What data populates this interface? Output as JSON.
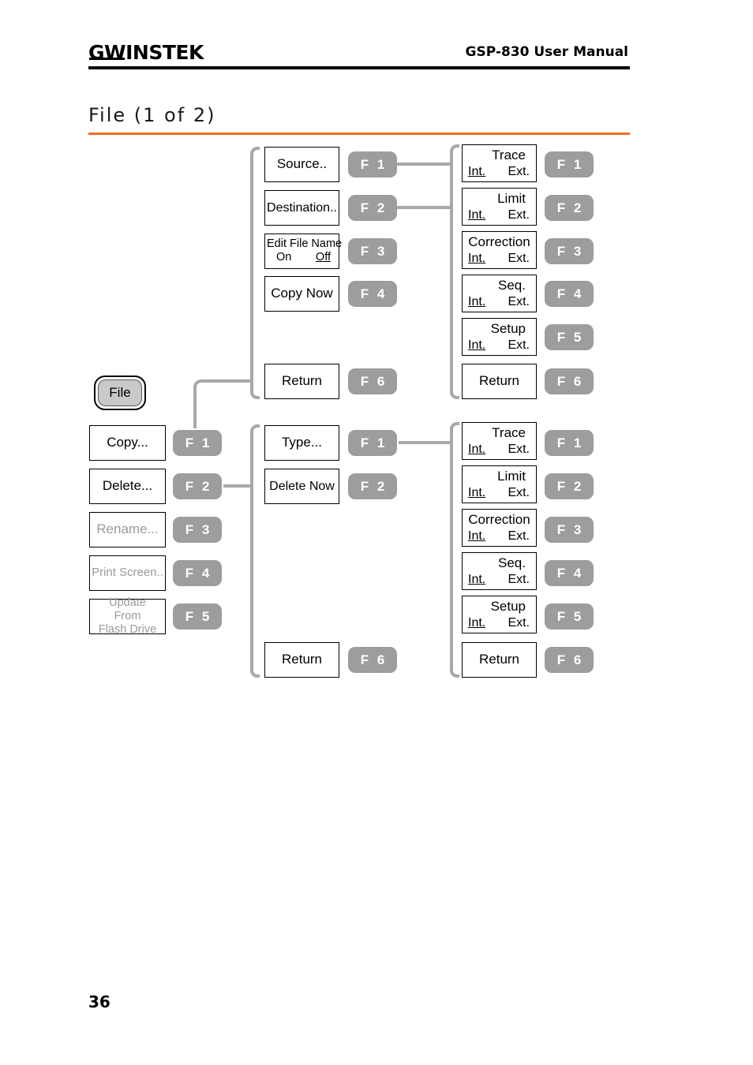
{
  "header": {
    "logo_gw": "GW",
    "logo_instek": "INSTEK",
    "manual_title": "GSP-830 User Manual"
  },
  "page": {
    "title": "File (1 of 2)",
    "number": "36",
    "accent_color": "#ef6f22",
    "connector_color": "#a8a8a8",
    "fkey_color": "#9d9d9d"
  },
  "hardkey": {
    "label": "File"
  },
  "column1": {
    "items": [
      {
        "label": "Copy...",
        "fkey": "F  1",
        "dim": false
      },
      {
        "label": "Delete...",
        "fkey": "F  2",
        "dim": false
      },
      {
        "label": "Rename...",
        "fkey": "F  3",
        "dim": true
      },
      {
        "label": "Print Screen..",
        "fkey": "F  4",
        "dim": true
      },
      {
        "label": "Update\nFrom\nFlash Drive",
        "line1": "Update",
        "line2": "From",
        "line3": "Flash Drive",
        "fkey": "F  5",
        "dim": true
      }
    ]
  },
  "column2_copy": {
    "items": [
      {
        "label": "Source..",
        "fkey": "F  1"
      },
      {
        "label": "Destination..",
        "fkey": "F  2"
      },
      {
        "label": "Edit File Name",
        "opt_left": "On",
        "opt_right": "Off",
        "selected": "Off",
        "fkey": "F  3"
      },
      {
        "label": "Copy Now",
        "fkey": "F  4"
      },
      {
        "label": "Return",
        "fkey": "F  6"
      }
    ]
  },
  "column3_copy": {
    "items": [
      {
        "label": "Trace",
        "opt_left": "Int.",
        "opt_right": "Ext.",
        "selected": "Int.",
        "fkey": "F  1"
      },
      {
        "label": "Limit",
        "opt_left": "Int.",
        "opt_right": "Ext.",
        "selected": "Int.",
        "fkey": "F  2"
      },
      {
        "label": "Correction",
        "opt_left": "Int.",
        "opt_right": "Ext.",
        "selected": "Int.",
        "fkey": "F  3"
      },
      {
        "label": "Seq.",
        "opt_left": "Int.",
        "opt_right": "Ext.",
        "selected": "Int.",
        "fkey": "F  4"
      },
      {
        "label": "Setup",
        "opt_left": "Int.",
        "opt_right": "Ext.",
        "selected": "Int.",
        "fkey": "F  5"
      },
      {
        "label": "Return",
        "fkey": "F  6"
      }
    ]
  },
  "column2_delete": {
    "items": [
      {
        "label": "Type...",
        "fkey": "F  1"
      },
      {
        "label": "Delete Now",
        "fkey": "F  2"
      },
      {
        "label": "Return",
        "fkey": "F  6"
      }
    ]
  },
  "column3_delete": {
    "items": [
      {
        "label": "Trace",
        "opt_left": "Int.",
        "opt_right": "Ext.",
        "selected": "Int.",
        "fkey": "F  1"
      },
      {
        "label": "Limit",
        "opt_left": "Int.",
        "opt_right": "Ext.",
        "selected": "Int.",
        "fkey": "F  2"
      },
      {
        "label": "Correction",
        "opt_left": "Int.",
        "opt_right": "Ext.",
        "selected": "Int.",
        "fkey": "F  3"
      },
      {
        "label": "Seq.",
        "opt_left": "Int.",
        "opt_right": "Ext.",
        "selected": "Int.",
        "fkey": "F  4"
      },
      {
        "label": "Setup",
        "opt_left": "Int.",
        "opt_right": "Ext.",
        "selected": "Int.",
        "fkey": "F  5"
      },
      {
        "label": "Return",
        "fkey": "F  6"
      }
    ]
  }
}
